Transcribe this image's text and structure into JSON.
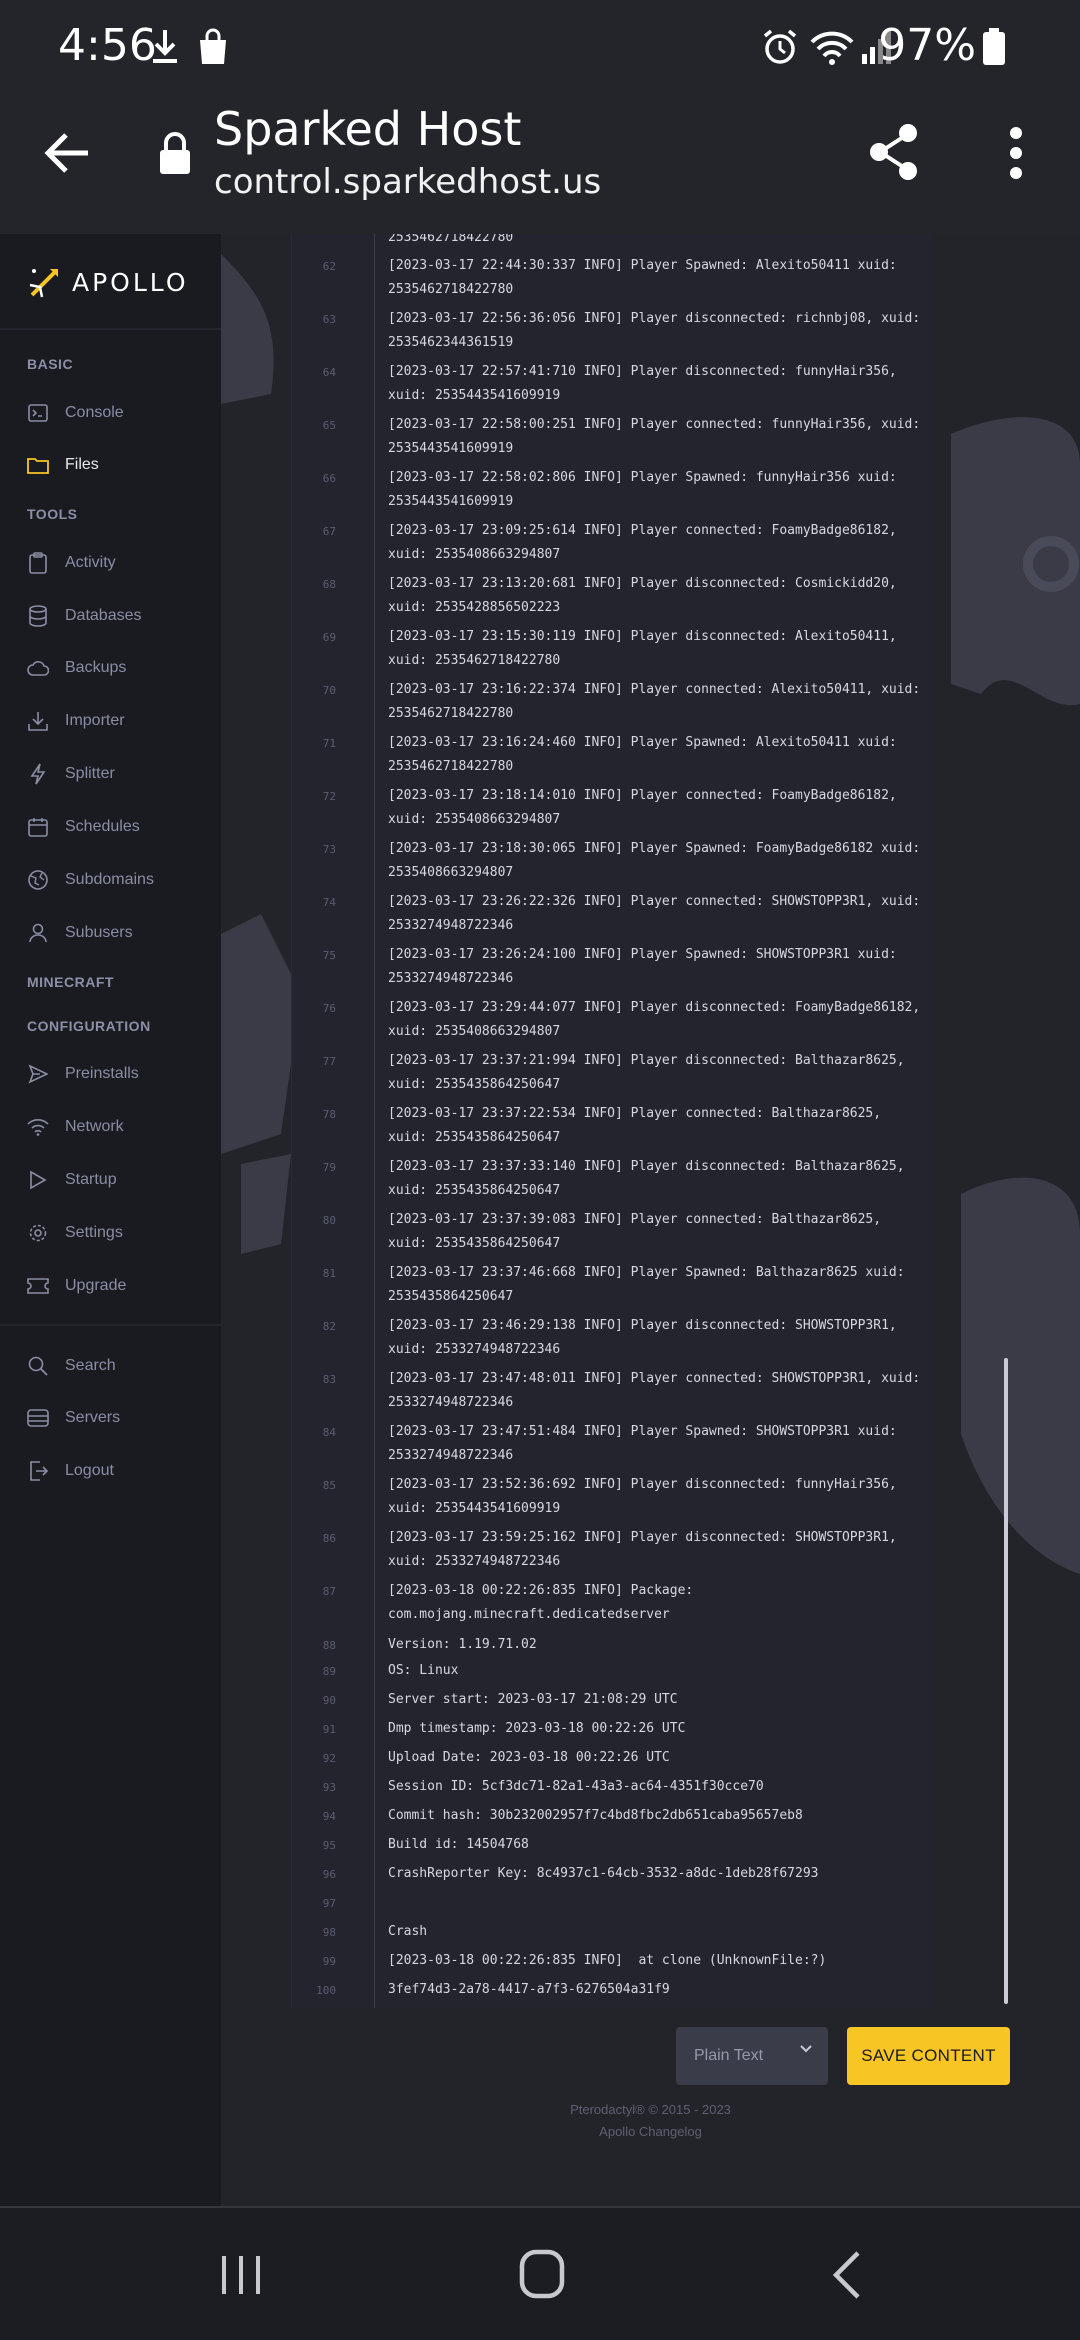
{
  "status_bar": {
    "time": "4:56",
    "battery": "97%"
  },
  "browser": {
    "title": "Sparked Host",
    "url": "control.sparkedhost.us"
  },
  "sidebar": {
    "logo_text": "APOLLO",
    "sections": {
      "basic": "BASIC",
      "tools": "TOOLS",
      "minecraft": "MINECRAFT",
      "configuration": "CONFIGURATION"
    },
    "items": {
      "console": "Console",
      "files": "Files",
      "activity": "Activity",
      "databases": "Databases",
      "backups": "Backups",
      "importer": "Importer",
      "splitter": "Splitter",
      "schedules": "Schedules",
      "subdomains": "Subdomains",
      "subusers": "Subusers",
      "preinstalls": "Preinstalls",
      "network": "Network",
      "startup": "Startup",
      "settings": "Settings",
      "upgrade": "Upgrade",
      "search": "Search",
      "servers": "Servers",
      "logout": "Logout"
    }
  },
  "editor": {
    "lines": [
      {
        "n": "",
        "text": "2535462718422780"
      },
      {
        "n": "62",
        "text": "[2023-03-17 22:44:30:337 INFO] Player Spawned: Alexito50411 xuid: 2535462718422780"
      },
      {
        "n": "63",
        "text": "[2023-03-17 22:56:36:056 INFO] Player disconnected: richnbj08, xuid: 2535462344361519"
      },
      {
        "n": "64",
        "text": "[2023-03-17 22:57:41:710 INFO] Player disconnected: funnyHair356, xuid: 2535443541609919"
      },
      {
        "n": "65",
        "text": "[2023-03-17 22:58:00:251 INFO] Player connected: funnyHair356, xuid: 2535443541609919"
      },
      {
        "n": "66",
        "text": "[2023-03-17 22:58:02:806 INFO] Player Spawned: funnyHair356 xuid: 2535443541609919"
      },
      {
        "n": "67",
        "text": "[2023-03-17 23:09:25:614 INFO] Player connected: FoamyBadge86182, xuid: 2535408663294807"
      },
      {
        "n": "68",
        "text": "[2023-03-17 23:13:20:681 INFO] Player disconnected: Cosmickidd20, xuid: 2535428856502223"
      },
      {
        "n": "69",
        "text": "[2023-03-17 23:15:30:119 INFO] Player disconnected: Alexito50411, xuid: 2535462718422780"
      },
      {
        "n": "70",
        "text": "[2023-03-17 23:16:22:374 INFO] Player connected: Alexito50411, xuid: 2535462718422780"
      },
      {
        "n": "71",
        "text": "[2023-03-17 23:16:24:460 INFO] Player Spawned: Alexito50411 xuid: 2535462718422780"
      },
      {
        "n": "72",
        "text": "[2023-03-17 23:18:14:010 INFO] Player connected: FoamyBadge86182, xuid: 2535408663294807"
      },
      {
        "n": "73",
        "text": "[2023-03-17 23:18:30:065 INFO] Player Spawned: FoamyBadge86182 xuid: 2535408663294807"
      },
      {
        "n": "74",
        "text": "[2023-03-17 23:26:22:326 INFO] Player connected: SHOWSTOPP3R1, xuid: 2533274948722346"
      },
      {
        "n": "75",
        "text": "[2023-03-17 23:26:24:100 INFO] Player Spawned: SHOWSTOPP3R1 xuid: 2533274948722346"
      },
      {
        "n": "76",
        "text": "[2023-03-17 23:29:44:077 INFO] Player disconnected: FoamyBadge86182, xuid: 2535408663294807"
      },
      {
        "n": "77",
        "text": "[2023-03-17 23:37:21:994 INFO] Player disconnected: Balthazar8625, xuid: 2535435864250647"
      },
      {
        "n": "78",
        "text": "[2023-03-17 23:37:22:534 INFO] Player connected: Balthazar8625, xuid: 2535435864250647"
      },
      {
        "n": "79",
        "text": "[2023-03-17 23:37:33:140 INFO] Player disconnected: Balthazar8625, xuid: 2535435864250647"
      },
      {
        "n": "80",
        "text": "[2023-03-17 23:37:39:083 INFO] Player connected: Balthazar8625, xuid: 2535435864250647"
      },
      {
        "n": "81",
        "text": "[2023-03-17 23:37:46:668 INFO] Player Spawned: Balthazar8625 xuid: 2535435864250647"
      },
      {
        "n": "82",
        "text": "[2023-03-17 23:46:29:138 INFO] Player disconnected: SHOWSTOPP3R1, xuid: 2533274948722346"
      },
      {
        "n": "83",
        "text": "[2023-03-17 23:47:48:011 INFO] Player connected: SHOWSTOPP3R1, xuid: 2533274948722346"
      },
      {
        "n": "84",
        "text": "[2023-03-17 23:47:51:484 INFO] Player Spawned: SHOWSTOPP3R1 xuid: 2533274948722346"
      },
      {
        "n": "85",
        "text": "[2023-03-17 23:52:36:692 INFO] Player disconnected: funnyHair356, xuid: 2535443541609919"
      },
      {
        "n": "86",
        "text": "[2023-03-17 23:59:25:162 INFO] Player disconnected: SHOWSTOPP3R1, xuid: 2533274948722346"
      },
      {
        "n": "87",
        "text": "[2023-03-18 00:22:26:835 INFO] Package: com.mojang.minecraft.dedicatedserver"
      },
      {
        "n": "88",
        "text": "Version: 1.19.71.02"
      },
      {
        "n": "89",
        "text": "OS: Linux"
      },
      {
        "n": "90",
        "text": "Server start: 2023-03-17 21:08:29 UTC"
      },
      {
        "n": "91",
        "text": "Dmp timestamp: 2023-03-18 00:22:26 UTC"
      },
      {
        "n": "92",
        "text": "Upload Date: 2023-03-18 00:22:26 UTC"
      },
      {
        "n": "93",
        "text": "Session ID: 5cf3dc71-82a1-43a3-ac64-4351f30cce70"
      },
      {
        "n": "94",
        "text": "Commit hash: 30b232002957f7c4bd8fbc2db651caba95657eb8"
      },
      {
        "n": "95",
        "text": "Build id: 14504768"
      },
      {
        "n": "96",
        "text": "CrashReporter Key: 8c4937c1-64cb-3532-a8dc-1deb28f67293"
      },
      {
        "n": "97",
        "text": ""
      },
      {
        "n": "98",
        "text": "Crash"
      },
      {
        "n": "99",
        "text": "[2023-03-18 00:22:26:835 INFO]  at clone (UnknownFile:?)"
      },
      {
        "n": "100",
        "text": "3fef74d3-2a78-4417-a7f3-6276504a31f9"
      }
    ],
    "mode": "Plain Text",
    "save_label": "SAVE CONTENT"
  },
  "footer": {
    "copyright": "Pterodactyl® © 2015 - 2023",
    "changelog": "Apollo Changelog"
  },
  "colors": {
    "accent": "#f7c625",
    "sidebar_bg": "#1a1b21",
    "editor_bg": "#23242e"
  }
}
